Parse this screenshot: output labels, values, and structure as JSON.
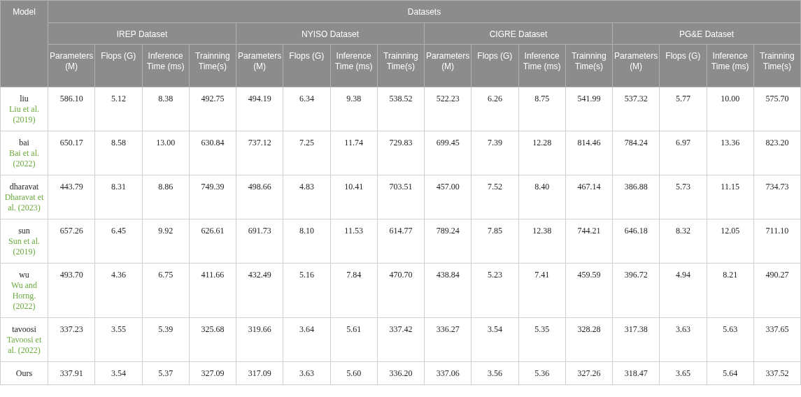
{
  "table": {
    "corner": "Model",
    "group_header": "Datasets",
    "datasets": [
      "IREP Dataset",
      "NYISO Dataset",
      "CIGRE Dataset",
      "PG&E Dataset"
    ],
    "metric_headers": [
      "Parameters (M)",
      "Flops (G)",
      "Inference Time (ms)",
      "Trainning Time(s)",
      "Parameters (M)",
      "Flops (G)",
      "Inference Time (ms)",
      "Trainning Time(s)",
      "Parameters (M)",
      "Flops (G)",
      "Inference Time (ms)",
      "Trainning Time(s)",
      "Parameters (M)",
      "Flops (G)",
      "Inference Time (ms)",
      "Trainning Time(s)"
    ],
    "rows": [
      {
        "model": "liu",
        "citation": "Liu et al. (2019)",
        "values": [
          "586.10",
          "5.12",
          "8.38",
          "492.75",
          "494.19",
          "6.34",
          "9.38",
          "538.52",
          "522.23",
          "6.26",
          "8.75",
          "541.99",
          "537.32",
          "5.77",
          "10.00",
          "575.70"
        ]
      },
      {
        "model": "bai",
        "citation": "Bai et al. (2022)",
        "values": [
          "650.17",
          "8.58",
          "13.00",
          "630.84",
          "737.12",
          "7.25",
          "11.74",
          "729.83",
          "699.45",
          "7.39",
          "12.28",
          "814.46",
          "784.24",
          "6.97",
          "13.36",
          "823.20"
        ]
      },
      {
        "model": "dharavat",
        "citation": "Dharavat et al. (2023)",
        "values": [
          "443.79",
          "8.31",
          "8.86",
          "749.39",
          "498.66",
          "4.83",
          "10.41",
          "703.51",
          "457.00",
          "7.52",
          "8.40",
          "467.14",
          "386.88",
          "5.73",
          "11.15",
          "734.73"
        ]
      },
      {
        "model": "sun",
        "citation": "Sun et al. (2019)",
        "values": [
          "657.26",
          "6.45",
          "9.92",
          "626.61",
          "691.73",
          "8.10",
          "11.53",
          "614.77",
          "789.24",
          "7.85",
          "12.38",
          "744.21",
          "646.18",
          "8.32",
          "12.05",
          "711.10"
        ]
      },
      {
        "model": "wu",
        "citation": "Wu and Horng. (2022)",
        "values": [
          "493.70",
          "4.36",
          "6.75",
          "411.66",
          "432.49",
          "5.16",
          "7.84",
          "470.70",
          "438.84",
          "5.23",
          "7.41",
          "459.59",
          "396.72",
          "4.94",
          "8.21",
          "490.27"
        ]
      },
      {
        "model": "tavoosi",
        "citation": "Tavoosi et al. (2022)",
        "values": [
          "337.23",
          "3.55",
          "5.39",
          "325.68",
          "319.66",
          "3.64",
          "5.61",
          "337.42",
          "336.27",
          "3.54",
          "5.35",
          "328.28",
          "317.38",
          "3.63",
          "5.63",
          "337.65"
        ]
      },
      {
        "model": "Ours",
        "values": [
          "337.91",
          "3.54",
          "5.37",
          "327.09",
          "317.09",
          "3.63",
          "5.60",
          "336.20",
          "337.06",
          "3.56",
          "5.36",
          "327.26",
          "318.47",
          "3.65",
          "5.64",
          "337.52"
        ]
      }
    ]
  }
}
